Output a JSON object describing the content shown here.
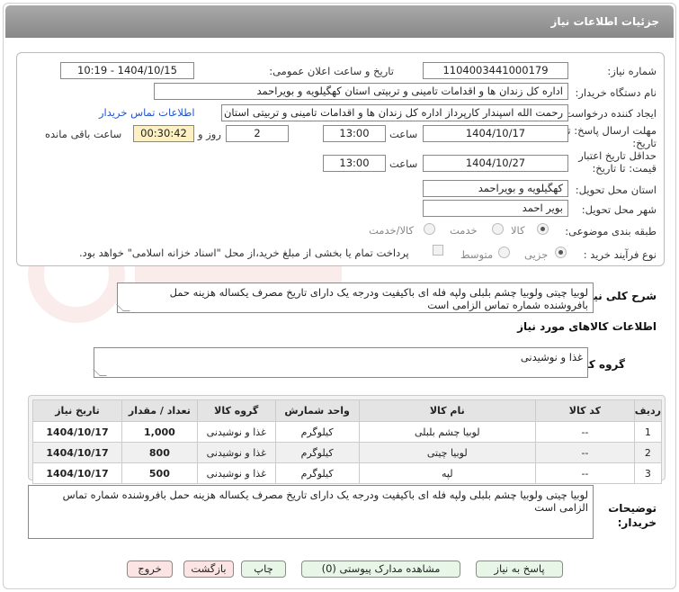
{
  "header": {
    "title": "جزئیات اطلاعات نیاز"
  },
  "form": {
    "need_number_label": "شماره نیاز:",
    "need_number": "1104003441000179",
    "announce_label": "تاریخ و ساعت اعلان عمومی:",
    "announce_value": "1404/10/15 - 10:19",
    "buyer_label": "نام دستگاه خریدار:",
    "buyer_value": "اداره کل زندان ها و اقدامات تامینی و تربیتی استان کهگیلویه و بویراحمد",
    "creator_label": "ایجاد کننده درخواست:",
    "creator_value": "رحمت الله اسپندار کارپرداز اداره کل زندان ها و اقدامات تامینی و تربیتی استان کهگیلویه و بویراحمد",
    "contact_link": "اطلاعات تماس خریدار",
    "deadline_label_1": "مهلت ارسال پاسخ: تا",
    "deadline_label_2": "تاریخ:",
    "deadline_date": "1404/10/17",
    "time_label": "ساعت",
    "deadline_time": "13:00",
    "days_value": "2",
    "days_label": "روز و",
    "remaining_value": "00:30:42",
    "remaining_label": "ساعت باقی مانده",
    "validity_label_1": "حداقل تاریخ اعتبار",
    "validity_label_2": "قیمت: تا تاریخ:",
    "validity_date": "1404/10/27",
    "validity_time": "13:00",
    "province_label": "استان محل تحویل:",
    "province_value": "کهگیلویه و بویراحمد",
    "city_label": "شهر محل تحویل:",
    "city_value": "بویر احمد",
    "category_label": "طبقه بندی موضوعی:",
    "category_options": [
      "کالا",
      "خدمت",
      "کالا/خدمت"
    ],
    "process_label": "نوع فرآیند خرید :",
    "process_options": [
      "جزیی",
      "متوسط"
    ],
    "payment_text": "پرداخت تمام یا بخشی از مبلغ خرید،از محل \"اسناد خزانه اسلامی\" خواهد بود."
  },
  "summary": {
    "label": "شرح کلی نیاز:",
    "text": "لوبیا چیتی ولوبیا چشم بلبلی ولپه  فله ای   باکیفیت ودرجه یک دارای تاریخ مصرف یکساله هزینه حمل بافروشنده شماره تماس الزامی است"
  },
  "goods": {
    "section_title": "اطلاعات کالاهای مورد نیاز",
    "group_label": "گروه کالا:",
    "group_value": "غذا و نوشیدنی"
  },
  "table": {
    "headers": [
      "ردیف",
      "کد کالا",
      "نام کالا",
      "واحد شمارش",
      "گروه کالا",
      "تعداد / مقدار",
      "تاریخ نیاز"
    ],
    "rows": [
      [
        "1",
        "--",
        "لوبیا چشم بلبلی",
        "کیلوگرم",
        "غذا و نوشیدنی",
        "1,000",
        "1404/10/17"
      ],
      [
        "2",
        "--",
        "لوبیا چیتی",
        "کیلوگرم",
        "غذا و نوشیدنی",
        "800",
        "1404/10/17"
      ],
      [
        "3",
        "--",
        "لپه",
        "کیلوگرم",
        "غذا و نوشیدنی",
        "500",
        "1404/10/17"
      ]
    ]
  },
  "buyer_notes": {
    "label_1": "توضیحات",
    "label_2": "خریدار:",
    "text": "لوبیا چیتی ولوبیا چشم بلبلی ولپه  فله ای   باکیفیت ودرجه یک دارای تاریخ مصرف یکساله هزینه حمل بافروشنده شماره تماس الزامی است"
  },
  "buttons": {
    "reply": "پاسخ به نیاز",
    "attachments": "مشاهده مدارک پیوستی (0)",
    "print": "چاپ",
    "back": "بازگشت",
    "exit": "خروج"
  },
  "colors": {
    "header": "#999999",
    "link": "#2255cc",
    "remaining_bg": "#fdf1c4",
    "button_green": "#e8f6e8",
    "button_red": "#fce4e4"
  }
}
